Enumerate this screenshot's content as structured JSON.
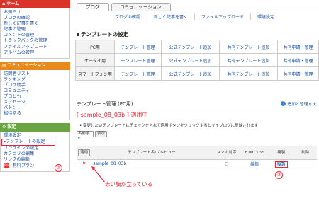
{
  "sidebar": {
    "home": {
      "title": "ホーム",
      "items": [
        "お知らせ",
        "ブログの確認",
        "新しく記事を書く",
        "記事の管理",
        "コメントの管理",
        "トラックバックの管理",
        "ファイルアップロード",
        "アルバムの管理"
      ]
    },
    "community": {
      "title": "コミュニケーション",
      "items": [
        "訪問者リスト",
        "ランキング",
        "ブログ助手",
        "コミュニティ",
        "プロとも",
        "メッセージ",
        "バトン",
        "招待する"
      ]
    },
    "settings": {
      "title": "設定",
      "items": [
        "環境設定",
        "テンプレートの設定",
        "プラグインの設定",
        "カテゴリの編集",
        "リンクの編集"
      ],
      "pro_badge": "Pro",
      "pro_item": "有料プラン"
    }
  },
  "tabs": [
    "ブログ",
    "コミュニケーション"
  ],
  "subnav": [
    "ブログの確認",
    "新しく記事を書く",
    "ファイルアップロード",
    "環境設定"
  ],
  "template_settings": {
    "heading": "テンプレートの設定",
    "rows": [
      {
        "label": "PC用",
        "cells": [
          "テンプレート管理",
          "公式テンプレート追加",
          "共有テンプレート追加",
          "共有申請・管理"
        ]
      },
      {
        "label": "ケータイ用",
        "cells": [
          "テンプレート管理",
          "公式テンプレート追加",
          "共有テンプレート追加",
          "共有申請・管理"
        ]
      },
      {
        "label": "スマートフォン用",
        "cells": [
          "テンプレート管理",
          "公式テンプレート追加",
          "共有テンプレート追加",
          "共有申請・管理"
        ]
      }
    ]
  },
  "template_manage": {
    "title": "テンプレート管理 (PC用)",
    "help": "追加と管理方法",
    "current": "[ sample_08_03b ] 適用中",
    "note": "変更したいテンプレートにチェックを入れて適用ボタンをクリックするとマイブログに反映されます",
    "sort_value": "名前順",
    "show_button": "表示"
  },
  "list": {
    "headers": {
      "apply": "適用",
      "name": "テンプレート名/プレビュー",
      "smartphone": "スマホ対応",
      "html_css": "HTML CSS",
      "copy": "複製",
      "delete": "削除"
    },
    "rows": [
      {
        "flag": "⚑",
        "name": "sample_08_03b",
        "smartphone": "○",
        "edit": "編集",
        "copy": "複製"
      }
    ]
  },
  "callouts": {
    "two": "②",
    "three": "③"
  },
  "annotation": "赤い旗が立っている"
}
